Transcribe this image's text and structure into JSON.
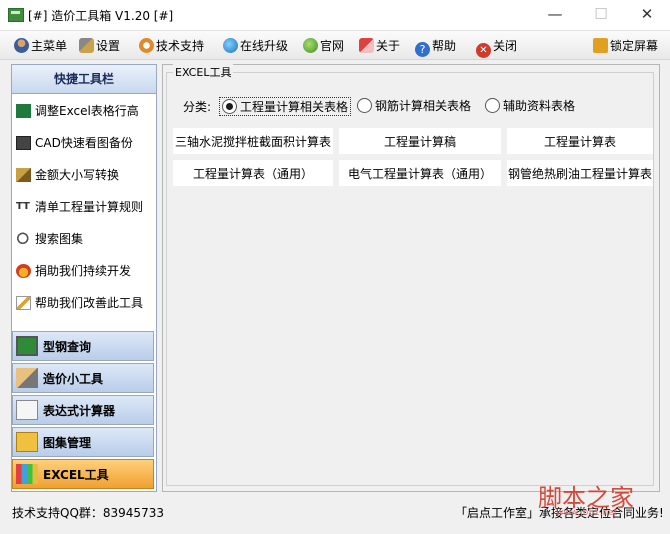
{
  "window": {
    "title": "[#] 造价工具箱 V1.20 [#]",
    "min": "—",
    "max": "☐",
    "close": "✕"
  },
  "toolbar": {
    "items": [
      {
        "label": "主菜单",
        "icon": "user-icon"
      },
      {
        "label": "设置",
        "icon": "tools-icon"
      },
      {
        "label": "技术支持",
        "icon": "support-icon"
      },
      {
        "label": "在线升级",
        "icon": "globe-icon"
      },
      {
        "label": "官网",
        "icon": "website-icon"
      },
      {
        "label": "关于",
        "icon": "about-icon"
      },
      {
        "label": "帮助",
        "icon": "help-icon"
      },
      {
        "label": "关闭",
        "icon": "close-icon"
      }
    ],
    "lock": "锁定屏幕"
  },
  "sidebar": {
    "header": "快捷工具栏",
    "items": [
      {
        "label": "调整Excel表格行高",
        "icon": "excel-icon"
      },
      {
        "label": "CAD快速看图备份",
        "icon": "cad-icon"
      },
      {
        "label": "金额大小写转换",
        "icon": "money-icon"
      },
      {
        "label": "清单工程量计算规则",
        "icon": "tt-icon"
      },
      {
        "label": "搜索图集",
        "icon": "search-icon"
      },
      {
        "label": "捐助我们持续开发",
        "icon": "medal-icon"
      },
      {
        "label": "帮助我们改善此工具",
        "icon": "pen-icon"
      }
    ],
    "categories": [
      {
        "label": "型钢查询",
        "icon": "steel-icon"
      },
      {
        "label": "造价小工具",
        "icon": "ruler-icon"
      },
      {
        "label": "表达式计算器",
        "icon": "calculator-icon"
      },
      {
        "label": "图集管理",
        "icon": "folder-icon"
      },
      {
        "label": "EXCEL工具",
        "icon": "excel-bars-icon"
      }
    ]
  },
  "main": {
    "group_title": "EXCEL工具",
    "category_label": "分类:",
    "radios": [
      {
        "label": "工程量计算相关表格",
        "checked": true
      },
      {
        "label": "钢筋计算相关表格",
        "checked": false
      },
      {
        "label": "辅助资料表格",
        "checked": false
      }
    ],
    "buttons": [
      "三轴水泥搅拌桩截面积计算表",
      "工程量计算稿",
      "工程量计算表",
      "工程量计算表（通用）",
      "电气工程量计算表（通用）",
      "钢管绝热刷油工程量计算表"
    ]
  },
  "status": {
    "qq": "技术支持QQ群：83945733",
    "ad": "「启点工作室」承接各类定位合同业务!"
  },
  "watermark": {
    "main": "脚本之家",
    "sub": "www.jb51.net"
  }
}
